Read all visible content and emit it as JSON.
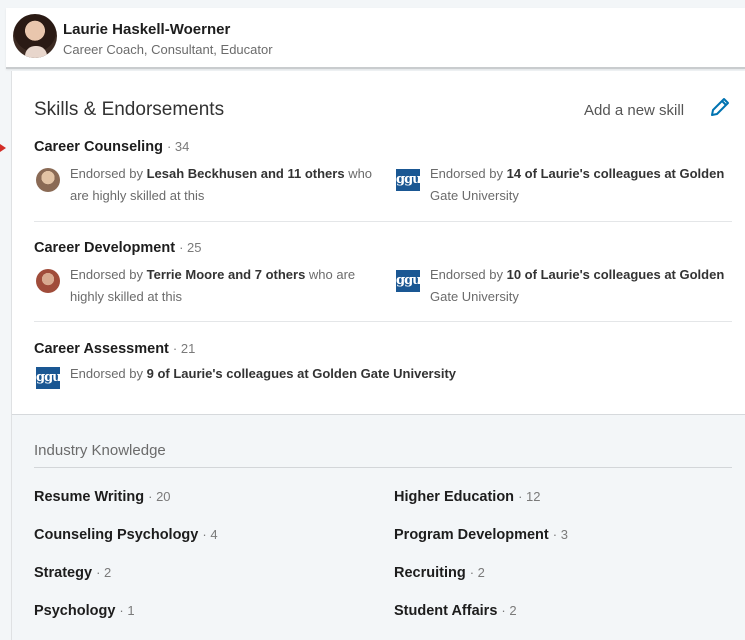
{
  "profile": {
    "name": "Laurie Haskell-Woerner",
    "headline": "Career Coach, Consultant, Educator"
  },
  "section": {
    "title": "Skills & Endorsements",
    "add_skill_label": "Add a new skill",
    "edit_icon": "pencil-icon"
  },
  "skills": [
    {
      "name": "Career Counseling",
      "count": "· 34",
      "left": {
        "prefix": "Endorsed by ",
        "bold": "Lesah Beckhusen and 11 others",
        "suffix": " who",
        "line2": "are highly skilled at this"
      },
      "right": {
        "prefix": "Endorsed by ",
        "bold": "14 of Laurie's colleagues at Golden",
        "line2": "Gate University"
      }
    },
    {
      "name": "Career Development",
      "count": "· 25",
      "left": {
        "prefix": "Endorsed by ",
        "bold": "Terrie Moore and 7 others",
        "suffix": " who are",
        "line2": "highly skilled at this"
      },
      "right": {
        "prefix": "Endorsed by ",
        "bold": "10 of Laurie's colleagues at Golden",
        "line2": "Gate University"
      }
    },
    {
      "name": "Career Assessment",
      "count": "· 21",
      "single": {
        "prefix": "Endorsed by ",
        "bold": "9 of Laurie's colleagues at Golden Gate University"
      }
    }
  ],
  "ggu_logo_text": "ggu",
  "industry": {
    "title": "Industry Knowledge",
    "items": [
      {
        "name": "Resume Writing",
        "count": "· 20"
      },
      {
        "name": "Higher Education",
        "count": "· 12"
      },
      {
        "name": "Counseling Psychology",
        "count": "· 4"
      },
      {
        "name": "Program Development",
        "count": "· 3"
      },
      {
        "name": "Strategy",
        "count": "· 2"
      },
      {
        "name": "Recruiting",
        "count": "· 2"
      },
      {
        "name": "Psychology",
        "count": "· 1"
      },
      {
        "name": "Student Affairs",
        "count": "· 2"
      }
    ]
  }
}
